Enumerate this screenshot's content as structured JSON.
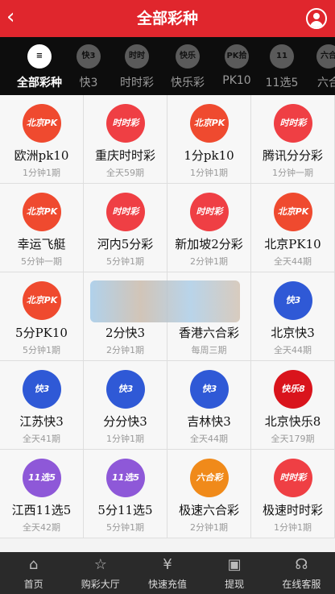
{
  "header": {
    "back_icon": "chevron-left-icon",
    "title": "全部彩种",
    "user_icon": "user-icon"
  },
  "categories": [
    {
      "label": "全部彩种",
      "icon": "layers-icon",
      "icon_text": "≡",
      "active": true
    },
    {
      "label": "快3",
      "icon": "k3-icon",
      "icon_text": "快3",
      "active": false
    },
    {
      "label": "时时彩",
      "icon": "ssc-icon",
      "icon_text": "时时",
      "active": false
    },
    {
      "label": "快乐彩",
      "icon": "happy-icon",
      "icon_text": "快乐",
      "active": false
    },
    {
      "label": "PK10",
      "icon": "pk10-icon",
      "icon_text": "PK拾",
      "active": false
    },
    {
      "label": "11选5",
      "icon": "11x5-icon",
      "icon_text": "11",
      "active": false
    },
    {
      "label": "六合",
      "icon": "lhc-icon",
      "icon_text": "六合",
      "active": false
    }
  ],
  "lotteries": [
    {
      "name": "欧洲pk10",
      "freq": "1分钟1期",
      "logo": "pk",
      "logo_text": "北京PK"
    },
    {
      "name": "重庆时时彩",
      "freq": "全天59期",
      "logo": "ssc",
      "logo_text": "时时彩"
    },
    {
      "name": "1分pk10",
      "freq": "1分钟1期",
      "logo": "pk",
      "logo_text": "北京PK"
    },
    {
      "name": "腾讯分分彩",
      "freq": "1分钟一期",
      "logo": "ssc",
      "logo_text": "时时彩"
    },
    {
      "name": "幸运飞艇",
      "freq": "5分钟一期",
      "logo": "pk",
      "logo_text": "北京PK"
    },
    {
      "name": "河内5分彩",
      "freq": "5分钟1期",
      "logo": "ssc",
      "logo_text": "时时彩"
    },
    {
      "name": "新加坡2分彩",
      "freq": "2分钟1期",
      "logo": "ssc",
      "logo_text": "时时彩"
    },
    {
      "name": "北京PK10",
      "freq": "全天44期",
      "logo": "pk",
      "logo_text": "北京PK"
    },
    {
      "name": "5分PK10",
      "freq": "5分钟1期",
      "logo": "pk",
      "logo_text": "北京PK"
    },
    {
      "name": "2分快3",
      "freq": "2分钟1期",
      "logo": "none",
      "logo_text": ""
    },
    {
      "name": "香港六合彩",
      "freq": "每周三期",
      "logo": "none",
      "logo_text": ""
    },
    {
      "name": "北京快3",
      "freq": "全天44期",
      "logo": "k3",
      "logo_text": "快3"
    },
    {
      "name": "江苏快3",
      "freq": "全天41期",
      "logo": "k3",
      "logo_text": "快3"
    },
    {
      "name": "分分快3",
      "freq": "1分钟1期",
      "logo": "k3",
      "logo_text": "快3"
    },
    {
      "name": "吉林快3",
      "freq": "全天44期",
      "logo": "k3",
      "logo_text": "快3"
    },
    {
      "name": "北京快乐8",
      "freq": "全天179期",
      "logo": "bj8",
      "logo_text": "快乐8"
    },
    {
      "name": "江西11选5",
      "freq": "全天42期",
      "logo": "x5",
      "logo_text": "11选5"
    },
    {
      "name": "5分11选5",
      "freq": "5分钟1期",
      "logo": "x5",
      "logo_text": "11选5"
    },
    {
      "name": "极速六合彩",
      "freq": "2分钟1期",
      "logo": "lhc",
      "logo_text": "六合彩"
    },
    {
      "name": "极速时时彩",
      "freq": "1分钟1期",
      "logo": "ssc",
      "logo_text": "时时彩"
    }
  ],
  "tabbar": [
    {
      "label": "首页",
      "icon": "home-icon",
      "glyph": "⌂"
    },
    {
      "label": "购彩大厅",
      "icon": "star-icon",
      "glyph": "☆"
    },
    {
      "label": "快速充值",
      "icon": "recharge-icon",
      "glyph": "¥"
    },
    {
      "label": "提现",
      "icon": "wallet-icon",
      "glyph": "▣"
    },
    {
      "label": "在线客服",
      "icon": "headset-icon",
      "glyph": "☊"
    }
  ],
  "colors": {
    "header_bg": "#e0262d",
    "category_bg": "#0d0d0d",
    "tabbar_bg": "#2a2a2a"
  }
}
